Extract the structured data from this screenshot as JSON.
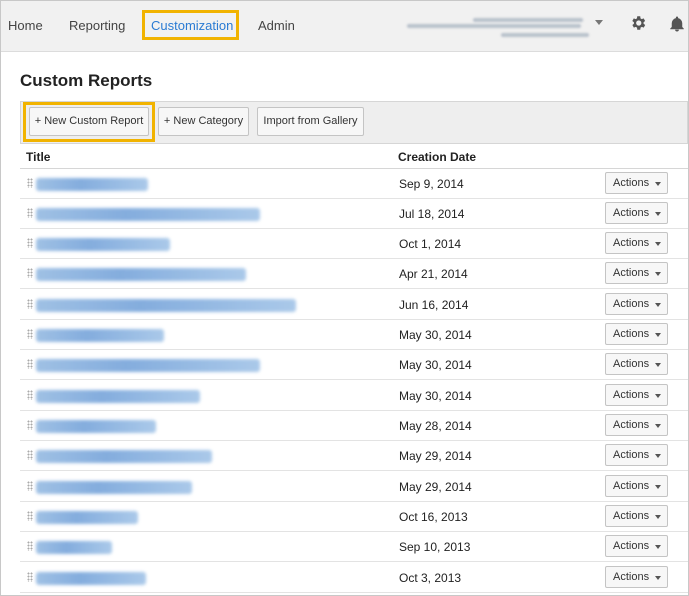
{
  "nav": {
    "home": "Home",
    "reporting": "Reporting",
    "customization": "Customization",
    "admin": "Admin"
  },
  "icons": {
    "settings": "gear-icon",
    "notifications": "bell-icon",
    "account_dropdown": "chevron-down-icon"
  },
  "colors": {
    "highlight": "#f1b300",
    "active_tab": "#2a7bd3",
    "link": "#6f9fd8"
  },
  "page_title": "Custom Reports",
  "toolbar": {
    "new_report": "+ New Custom Report",
    "new_category": "+ New Category",
    "import_gallery": "Import from Gallery"
  },
  "table": {
    "col_title": "Title",
    "col_date": "Creation Date",
    "actions_label": "Actions",
    "rows": [
      {
        "date": "Sep 9, 2014"
      },
      {
        "date": "Jul 18, 2014"
      },
      {
        "date": "Oct 1, 2014"
      },
      {
        "date": "Apr 21, 2014"
      },
      {
        "date": "Jun 16, 2014"
      },
      {
        "date": "May 30, 2014"
      },
      {
        "date": "May 30, 2014"
      },
      {
        "date": "May 30, 2014"
      },
      {
        "date": "May 28, 2014"
      },
      {
        "date": "May 29, 2014"
      },
      {
        "date": "May 29, 2014"
      },
      {
        "date": "Oct 16, 2013"
      },
      {
        "date": "Sep 10, 2013"
      },
      {
        "date": "Oct 3, 2013"
      }
    ]
  }
}
